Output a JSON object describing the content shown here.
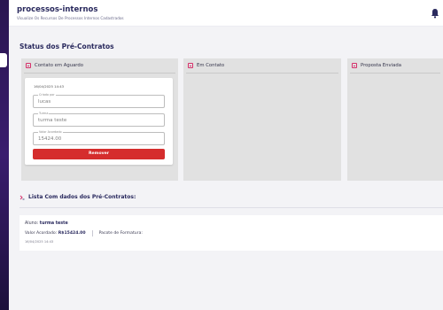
{
  "app": {
    "title": "processos-internos",
    "subtitle": "Visualize Os Recursos De Processos Internos Cadastrados"
  },
  "board": {
    "title": "Status dos Pré-Contratos",
    "columns": [
      {
        "title": "Contato em Aguardo",
        "icon": "kanban-icon"
      },
      {
        "title": "Em Contato",
        "icon": "kanban-icon"
      },
      {
        "title": "Proposta Enviada",
        "icon": "kanban-icon"
      }
    ]
  },
  "card": {
    "timestamp": "16/04/2025 14:43",
    "fields": [
      {
        "label": "Criado por",
        "value": "lucas"
      },
      {
        "label": "Turma",
        "value": "turma teste"
      },
      {
        "label": "Valor Acordado",
        "value": "15424.00"
      }
    ],
    "remove_label": "Remover"
  },
  "list": {
    "title": "Lista Com dados dos Pré-Contratos:",
    "items": [
      {
        "aluno_label": "Aluno:",
        "aluno_value": "turma teste",
        "valor_label": "Valor Acordado:",
        "valor_value": "R$15424.00",
        "pacote_label": "Pacote de Formatura:",
        "pacote_value": "",
        "timestamp": "16/04/2025 14:43"
      }
    ]
  },
  "colors": {
    "sidebar": "#2a1650",
    "accent_pink": "#d6306b",
    "remove_button": "#d52d2d",
    "heading": "#2a2a5e"
  }
}
